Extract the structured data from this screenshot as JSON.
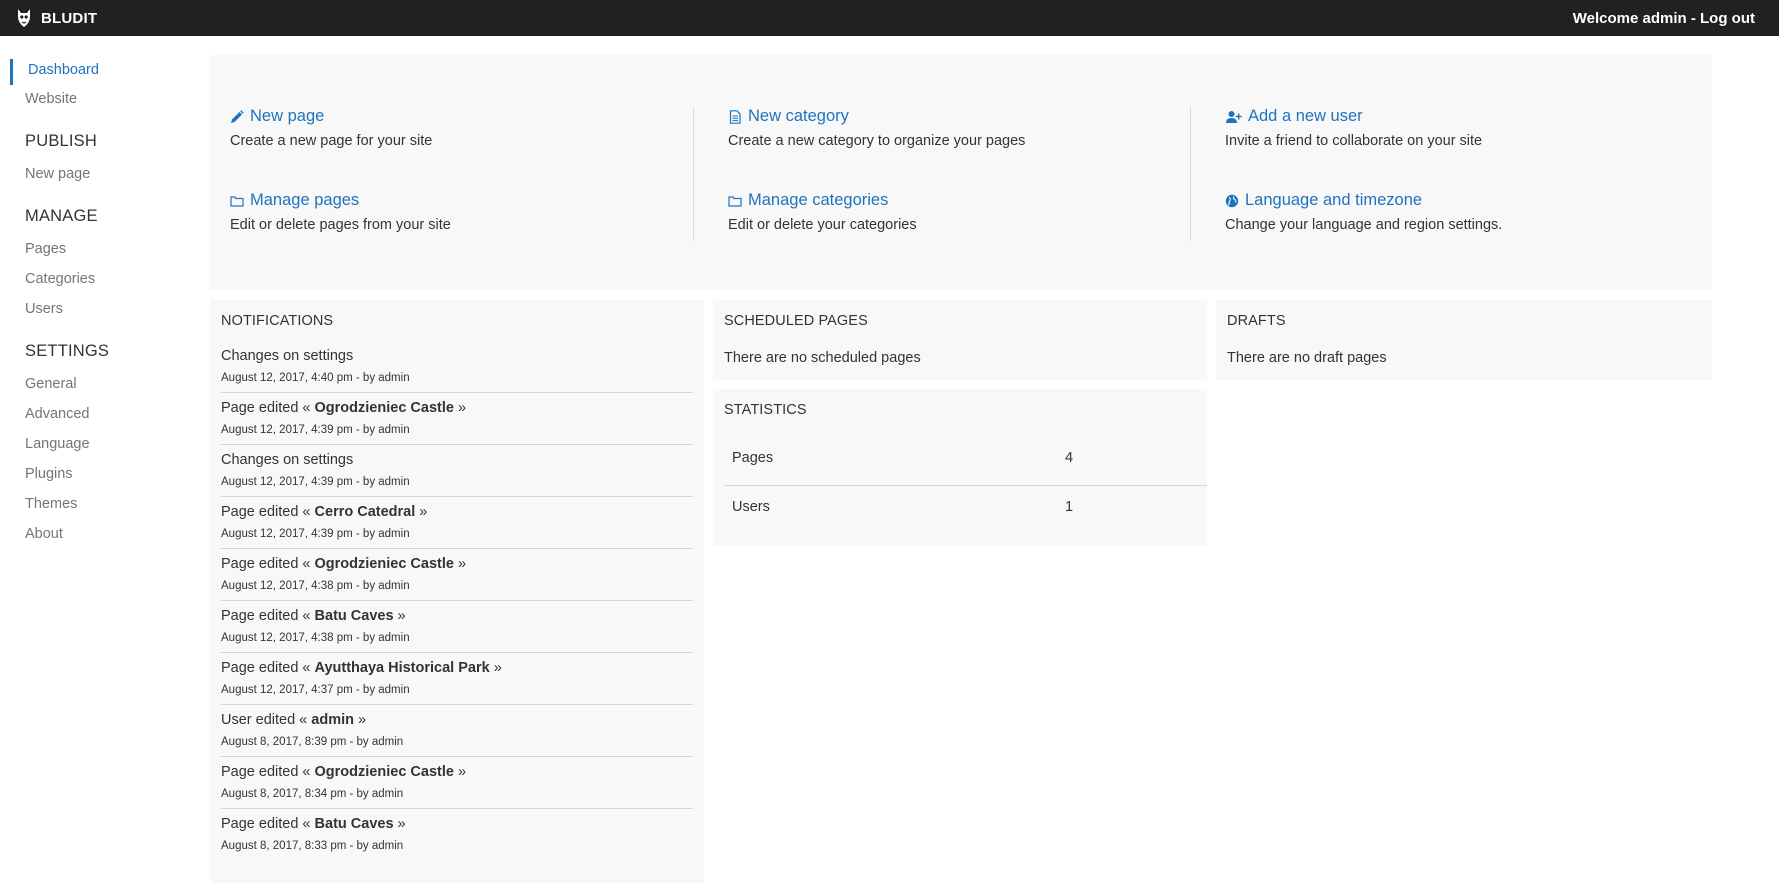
{
  "topbar": {
    "brand": "BLUDIT",
    "welcome": "Welcome admin",
    "separator": " - ",
    "logout": "Log out"
  },
  "sidebar": {
    "dashboard": "Dashboard",
    "website": "Website",
    "publish_heading": "PUBLISH",
    "new_page": "New page",
    "manage_heading": "MANAGE",
    "pages": "Pages",
    "categories": "Categories",
    "users": "Users",
    "settings_heading": "SETTINGS",
    "general": "General",
    "advanced": "Advanced",
    "language": "Language",
    "plugins": "Plugins",
    "themes": "Themes",
    "about": "About"
  },
  "quick": {
    "new_page": {
      "label": "New page",
      "desc": "Create a new page for your site",
      "icon": "pencil-icon"
    },
    "manage_pages": {
      "label": "Manage pages",
      "desc": "Edit or delete pages from your site",
      "icon": "folder-icon"
    },
    "new_category": {
      "label": "New category",
      "desc": "Create a new category to organize your pages",
      "icon": "document-icon"
    },
    "manage_categories": {
      "label": "Manage categories",
      "desc": "Edit or delete your categories",
      "icon": "folder-icon"
    },
    "add_user": {
      "label": "Add a new user",
      "desc": "Invite a friend to collaborate on your site",
      "icon": "user-plus-icon"
    },
    "language": {
      "label": "Language and timezone",
      "desc": "Change your language and region settings.",
      "icon": "globe-icon"
    }
  },
  "notifications": {
    "title": "NOTIFICATIONS",
    "items": [
      {
        "prefix": "Changes on settings",
        "name": "",
        "open": "",
        "close": "",
        "time": "August 12, 2017, 4:40 pm - by admin"
      },
      {
        "prefix": "Page edited",
        "name": "Ogrodzieniec Castle",
        "open": " « ",
        "close": " »",
        "time": "August 12, 2017, 4:39 pm - by admin"
      },
      {
        "prefix": "Changes on settings",
        "name": "",
        "open": "",
        "close": "",
        "time": "August 12, 2017, 4:39 pm - by admin"
      },
      {
        "prefix": "Page edited",
        "name": "Cerro Catedral",
        "open": " « ",
        "close": " »",
        "time": "August 12, 2017, 4:39 pm - by admin"
      },
      {
        "prefix": "Page edited",
        "name": "Ogrodzieniec Castle",
        "open": " « ",
        "close": " »",
        "time": "August 12, 2017, 4:38 pm - by admin"
      },
      {
        "prefix": "Page edited",
        "name": "Batu Caves",
        "open": " « ",
        "close": " »",
        "time": "August 12, 2017, 4:38 pm - by admin"
      },
      {
        "prefix": "Page edited",
        "name": "Ayutthaya Historical Park",
        "open": " « ",
        "close": " »",
        "time": "August 12, 2017, 4:37 pm - by admin"
      },
      {
        "prefix": "User edited",
        "name": "admin",
        "open": " « ",
        "close": " »",
        "time": "August 8, 2017, 8:39 pm - by admin"
      },
      {
        "prefix": "Page edited",
        "name": "Ogrodzieniec Castle",
        "open": " « ",
        "close": " »",
        "time": "August 8, 2017, 8:34 pm - by admin"
      },
      {
        "prefix": "Page edited",
        "name": "Batu Caves",
        "open": " « ",
        "close": " »",
        "time": "August 8, 2017, 8:33 pm - by admin"
      }
    ]
  },
  "scheduled": {
    "title": "SCHEDULED PAGES",
    "empty": "There are no scheduled pages"
  },
  "drafts": {
    "title": "DRAFTS",
    "empty": "There are no draft pages"
  },
  "statistics": {
    "title": "STATISTICS",
    "rows": [
      {
        "label": "Pages",
        "value": "4"
      },
      {
        "label": "Users",
        "value": "1"
      }
    ]
  },
  "colors": {
    "accent": "#1e73be",
    "topbar": "#212121",
    "panel": "#f8f8f8"
  }
}
